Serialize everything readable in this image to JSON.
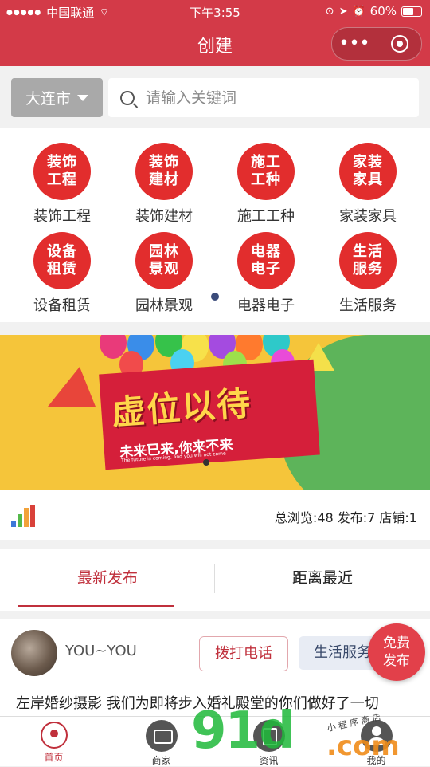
{
  "status_bar": {
    "carrier": "中国联通",
    "time": "下午3:55",
    "battery": "60%"
  },
  "nav": {
    "title": "创建",
    "more_label": "•••"
  },
  "search": {
    "city": "大连市",
    "placeholder": "请输入关键词"
  },
  "categories": [
    {
      "icon_text": [
        "装饰",
        "工程"
      ],
      "label": "装饰工程"
    },
    {
      "icon_text": [
        "装饰",
        "建材"
      ],
      "label": "装饰建材"
    },
    {
      "icon_text": [
        "施工",
        "工种"
      ],
      "label": "施工工种"
    },
    {
      "icon_text": [
        "家装",
        "家具"
      ],
      "label": "家装家具"
    },
    {
      "icon_text": [
        "设备",
        "租赁"
      ],
      "label": "设备租赁"
    },
    {
      "icon_text": [
        "园林",
        "景观"
      ],
      "label": "园林景观"
    },
    {
      "icon_text": [
        "电器",
        "电子"
      ],
      "label": "电器电子"
    },
    {
      "icon_text": [
        "生活",
        "服务"
      ],
      "label": "生活服务"
    }
  ],
  "banner": {
    "headline": "虚位以待",
    "subline": "未来已来,你来不来",
    "small": "The future is coming, and you will not come"
  },
  "stats": {
    "text": "总浏览:48 发布:7 店铺:1"
  },
  "tabs": {
    "latest": "最新发布",
    "nearest": "距离最近"
  },
  "post": {
    "user": "YOU~YOU",
    "call_label": "拨打电话",
    "category_label": "生活服务",
    "description": "左岸婚纱摄影 我们为即将步入婚礼殿堂的你们做好了一切"
  },
  "fab": {
    "line1": "免费",
    "line2": "发布"
  },
  "tabbar": [
    {
      "label": "首页"
    },
    {
      "label": "商家"
    },
    {
      "label": "资讯"
    },
    {
      "label": "我的"
    }
  ],
  "watermark": {
    "main": "91d",
    "domain": ".com",
    "small": "小 程 序 商 店"
  },
  "colors": {
    "brand": "#d33a48",
    "icon_red": "#e22d2d",
    "banner_yellow": "#f5c53a",
    "banner_green": "#5db45a"
  }
}
